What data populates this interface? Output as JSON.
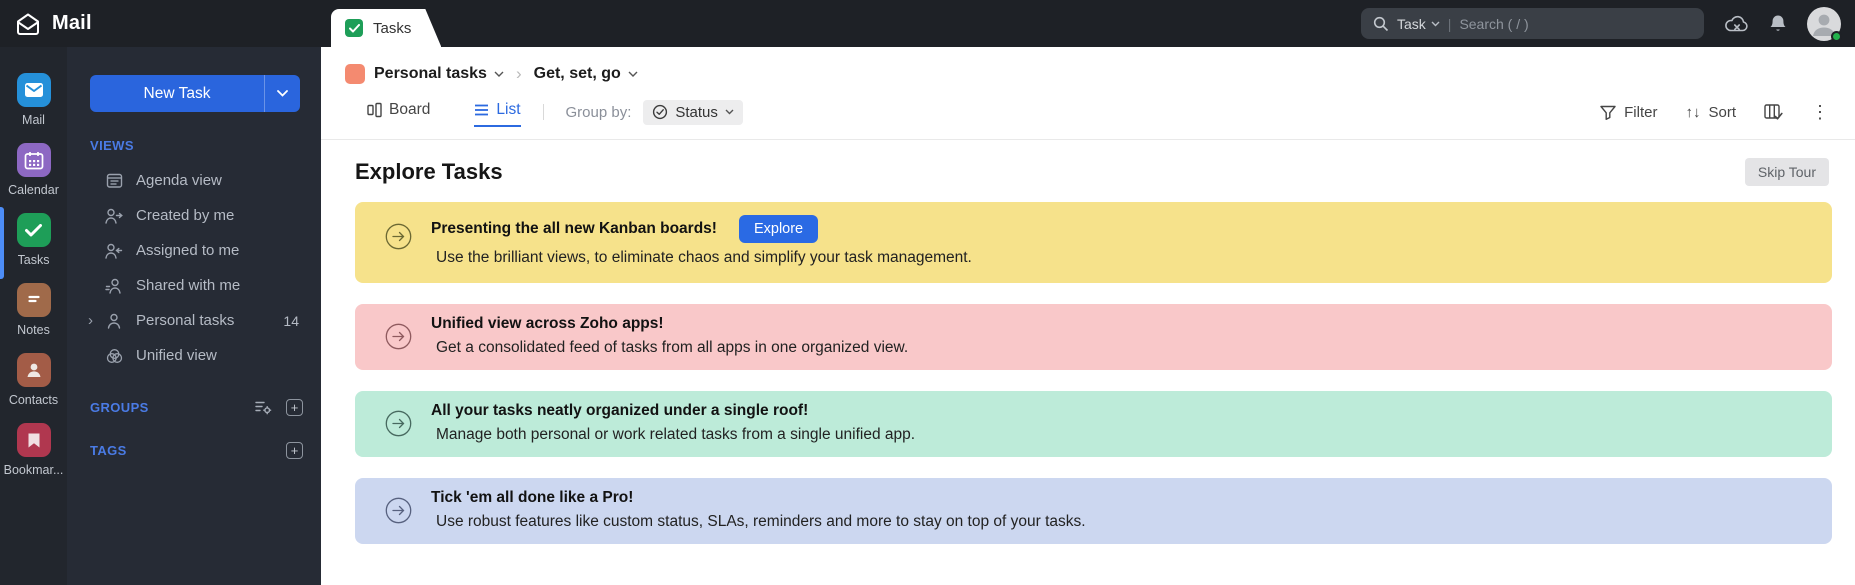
{
  "topbar": {
    "app_title": "Mail",
    "tab_label": "Tasks",
    "search": {
      "scope": "Task",
      "placeholder": "Search ( / )",
      "divider": "|"
    }
  },
  "rail": {
    "items": [
      {
        "label": "Mail",
        "color": "#2590d9"
      },
      {
        "label": "Calendar",
        "color": "#8d68c3"
      },
      {
        "label": "Tasks",
        "color": "#1e9e58"
      },
      {
        "label": "Notes",
        "color": "#a06a4a"
      },
      {
        "label": "Contacts",
        "color": "#a35c47"
      },
      {
        "label": "Bookmar...",
        "color": "#b0374f"
      }
    ]
  },
  "sidebar": {
    "new_task_label": "New Task",
    "views_label": "VIEWS",
    "items": [
      {
        "label": "Agenda view"
      },
      {
        "label": "Created by me"
      },
      {
        "label": "Assigned to me"
      },
      {
        "label": "Shared with me"
      },
      {
        "label": "Personal tasks",
        "count": "14"
      },
      {
        "label": "Unified view"
      }
    ],
    "groups_label": "GROUPS",
    "tags_label": "TAGS"
  },
  "content": {
    "breadcrumb": {
      "list_name": "Personal tasks",
      "task_name": "Get, set, go",
      "list_color": "#f48a70"
    },
    "toolbar": {
      "board_label": "Board",
      "list_label": "List",
      "group_by_label": "Group by:",
      "status_label": "Status",
      "filter_label": "Filter",
      "sort_label": "Sort"
    },
    "heading": "Explore Tasks",
    "skip_tour_label": "Skip Tour",
    "banners": [
      {
        "title": "Presenting the all new Kanban boards!",
        "subtitle": "Use the brilliant views, to eliminate chaos and simplify your task management.",
        "button": "Explore",
        "bg": "#f6e28b",
        "icon_color": "#6b6833"
      },
      {
        "title": "Unified view across Zoho apps!",
        "subtitle": "Get a consolidated feed of tasks from all apps in one organized view.",
        "bg": "#f9c8c9",
        "icon_color": "#8f5a5e"
      },
      {
        "title": "All your tasks neatly organized under a single roof!",
        "subtitle": "Manage both personal or work related tasks from a single unified app.",
        "bg": "#bdebd9",
        "icon_color": "#47695f"
      },
      {
        "title": "Tick 'em all done like a Pro!",
        "subtitle": "Use robust features like custom status, SLAs, reminders and more to stay on top of your tasks.",
        "bg": "#ccd7f0",
        "icon_color": "#57617f"
      }
    ]
  },
  "icons": {
    "sort_glyph": "↑↓",
    "more_glyph": "⋮",
    "crumb_sep": "›",
    "plus_glyph": "+",
    "expander_glyph": "›"
  },
  "colors": {
    "accent_blue": "#2a6ae4",
    "topbar_bg": "#1e2126",
    "sidebar_bg": "#262b35",
    "active_green": "#1e9e58"
  }
}
